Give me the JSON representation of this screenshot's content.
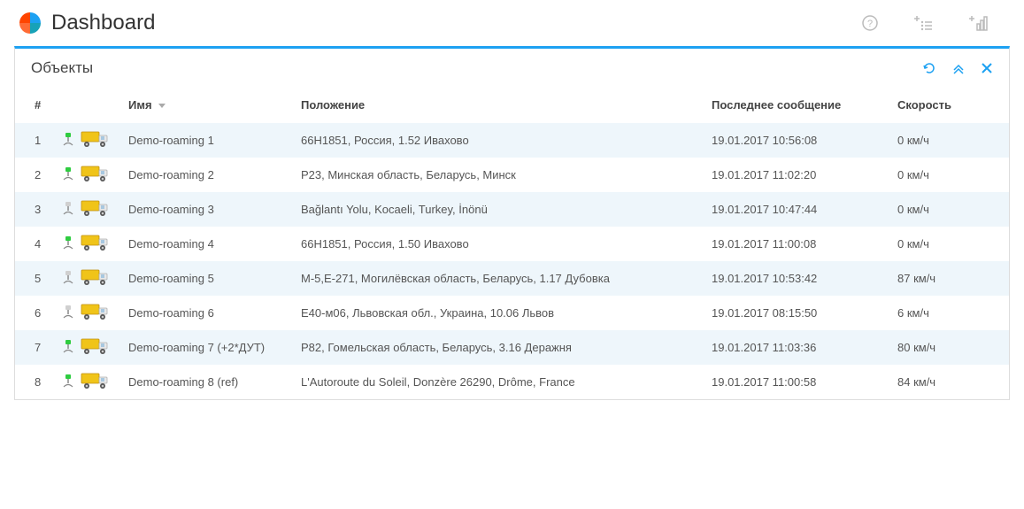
{
  "header": {
    "title": "Dashboard"
  },
  "panel": {
    "title": "Объекты"
  },
  "columns": {
    "num": "#",
    "name": "Имя",
    "position": "Положение",
    "last_message": "Последнее сообщение",
    "speed": "Скорость"
  },
  "rows": [
    {
      "num": "1",
      "status": "green",
      "name": "Demo-roaming 1",
      "position": "66Н1851, Россия, 1.52 Ивахово",
      "last": "19.01.2017 10:56:08",
      "speed": "0 км/ч"
    },
    {
      "num": "2",
      "status": "green",
      "name": "Demo-roaming 2",
      "position": "P23, Минская область, Беларусь, Минск",
      "last": "19.01.2017 11:02:20",
      "speed": "0 км/ч"
    },
    {
      "num": "3",
      "status": "gray",
      "name": "Demo-roaming 3",
      "position": "Bağlantı Yolu, Kocaeli, Turkey, İnönü",
      "last": "19.01.2017 10:47:44",
      "speed": "0 км/ч"
    },
    {
      "num": "4",
      "status": "green",
      "name": "Demo-roaming 4",
      "position": "66Н1851, Россия, 1.50 Ивахово",
      "last": "19.01.2017 11:00:08",
      "speed": "0 км/ч"
    },
    {
      "num": "5",
      "status": "gray",
      "name": "Demo-roaming 5",
      "position": "М-5,Е-271, Могилёвская область, Беларусь, 1.17 Дубовка",
      "last": "19.01.2017 10:53:42",
      "speed": "87 км/ч"
    },
    {
      "num": "6",
      "status": "gray",
      "name": "Demo-roaming 6",
      "position": "Е40-м06, Львовская обл., Украина, 10.06 Львов",
      "last": "19.01.2017 08:15:50",
      "speed": "6 км/ч"
    },
    {
      "num": "7",
      "status": "green",
      "name": "Demo-roaming 7 (+2*ДУТ)",
      "position": "Р82, Гомельская область, Беларусь, 3.16 Деражня",
      "last": "19.01.2017 11:03:36",
      "speed": "80 км/ч"
    },
    {
      "num": "8",
      "status": "green",
      "name": "Demo-roaming 8 (ref)",
      "position": "L'Autoroute du Soleil, Donzère 26290, Drôme, France",
      "last": "19.01.2017 11:00:58",
      "speed": "84 км/ч"
    }
  ]
}
